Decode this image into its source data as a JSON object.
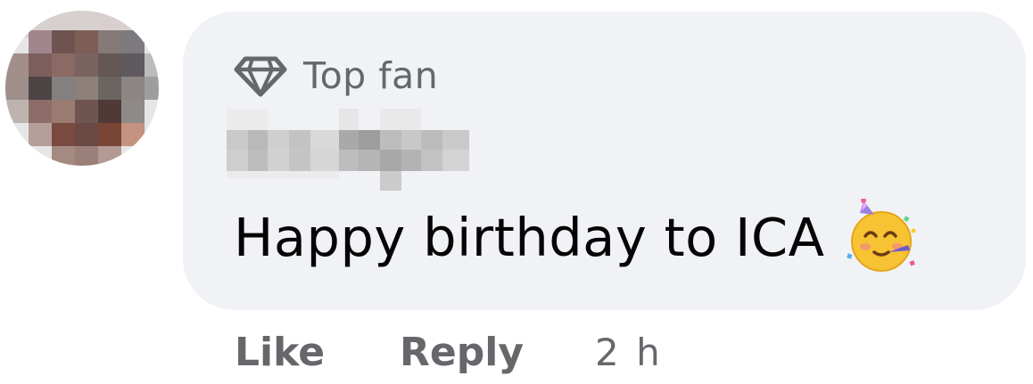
{
  "comment": {
    "badge": {
      "icon": "diamond-icon",
      "label": "Top fan"
    },
    "author_redacted": true,
    "text": "Happy birthday to ICA",
    "emoji": "partying-face-emoji",
    "actions": {
      "like": "Like",
      "reply": "Reply"
    },
    "timestamp": "2 h"
  },
  "colors": {
    "bubble": "#f0f2f5",
    "secondary_text": "#65676b",
    "primary_text": "#050505"
  }
}
